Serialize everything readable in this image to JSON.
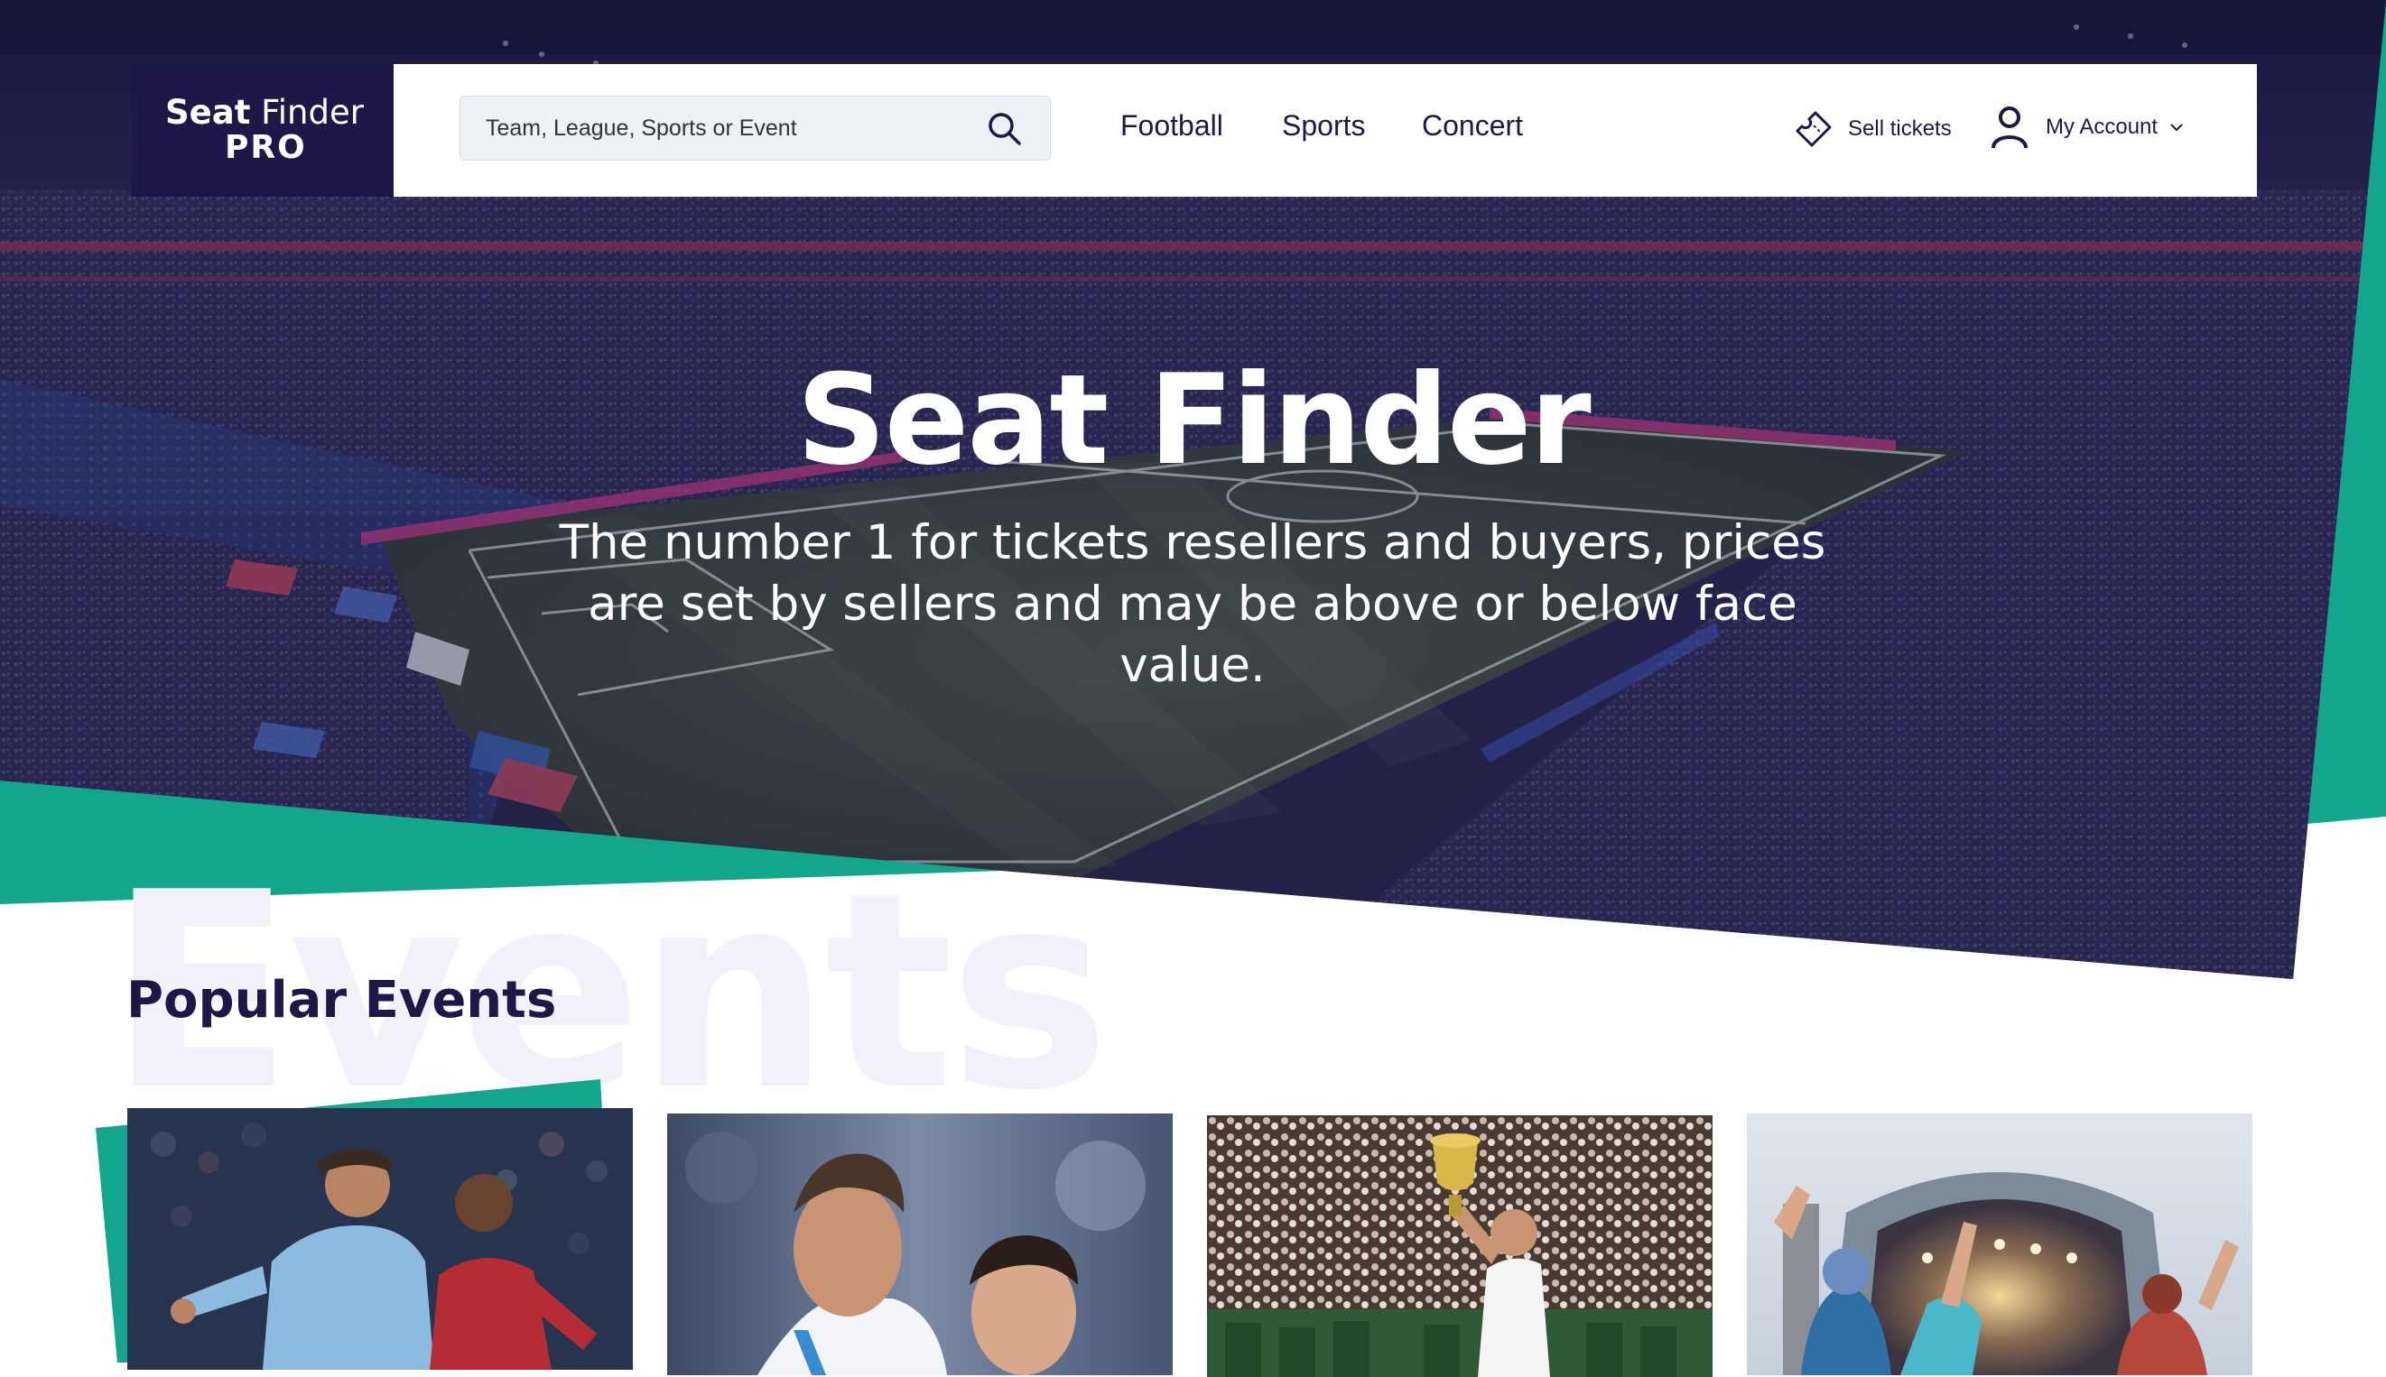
{
  "brand": {
    "line1_bold": "Seat",
    "line1_light": "Finder",
    "line2": "PRO",
    "navy": "#1e1848",
    "teal": "#14a68c"
  },
  "search": {
    "placeholder": "Team, League, Sports or Event",
    "icon": "search-icon"
  },
  "nav": {
    "links": [
      "Football",
      "Sports",
      "Concert"
    ],
    "sell_label": "Sell tickets",
    "sell_icon": "ticket-icon",
    "account_label": "My Account",
    "account_icon": "user-icon",
    "account_chevron": "chevron-down-icon"
  },
  "hero": {
    "title": "Seat Finder",
    "subtitle": "The number 1 for tickets resellers and buyers, prices are set by sellers and may be above or below face value."
  },
  "popular": {
    "watermark": "Events",
    "title": "Popular Events",
    "cards": [
      {
        "image": "football-players-photo"
      },
      {
        "image": "football-star-photo"
      },
      {
        "image": "tennis-trophy-photo"
      },
      {
        "image": "concert-crowd-photo"
      }
    ]
  }
}
